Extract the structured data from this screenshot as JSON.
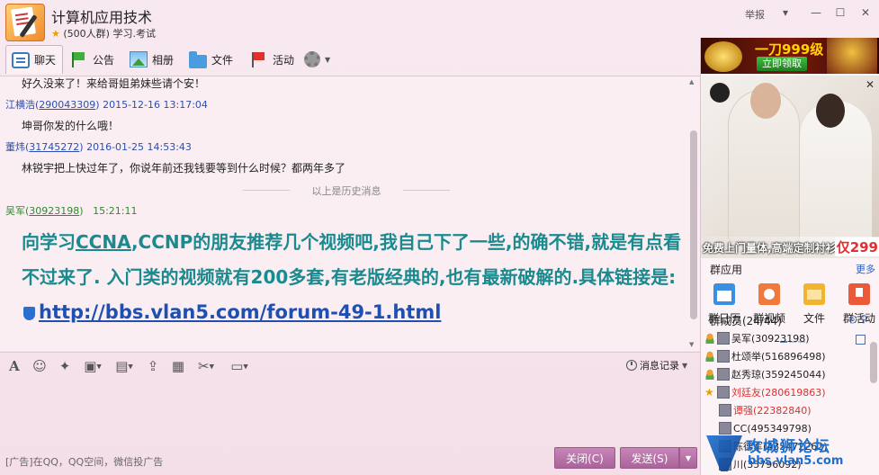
{
  "window": {
    "group_name": "计算机应用技术",
    "group_info": "(500人群) 学习.考试",
    "report_label": "举报",
    "controls": [
      "▾",
      "—",
      "☐",
      "✕"
    ]
  },
  "tabs": [
    {
      "label": "聊天",
      "icon": "chat-bubble-icon"
    },
    {
      "label": "公告",
      "icon": "flag-icon"
    },
    {
      "label": "相册",
      "icon": "photo-icon"
    },
    {
      "label": "文件",
      "icon": "folder-icon"
    },
    {
      "label": "活动",
      "icon": "red-flag-icon"
    }
  ],
  "messages": [
    {
      "text": "好久没来了！来给哥姐弟妹些请个安！"
    },
    {
      "sender": "江横浩",
      "qq": "290043309",
      "time": "2015-12-16 13:17:04",
      "text": "坤哥你发的什么哦！"
    },
    {
      "sender": "董炜",
      "qq": "31745272",
      "time": "2016-01-25 14:53:43",
      "text": "林锐宇把上快过年了，你说年前还我钱要等到什么时候？都两年多了"
    }
  ],
  "history_divider": "以上是历史消息",
  "latest": {
    "sender": "吴军",
    "qq": "30923198",
    "time": "15:21:11",
    "text_1": "向学习",
    "text_ccna": "CCNA",
    "text_2": ",CCNP的朋友推荐几个视频吧,我自己下了一些,的确不错,就是有点看不过来了. 入门类的视频就有200多套,有老版经典的,也有最新破解的.具体链接是:",
    "link": "http://bbs.vlan5.com/forum-49-1.html"
  },
  "input_toolbar": {
    "history_label": "消息记录"
  },
  "bottom": {
    "ad_text": "[广告]在QQ，QQ空间，微信投广告",
    "close_label": "关闭(C)",
    "send_label": "发送(S)"
  },
  "right_panel": {
    "banner_text": "一刀999级",
    "banner_button": "立即领取",
    "ad_caption": "免费上门量体,高端定制衬衫",
    "ad_price": "仅299",
    "apps_title": "群应用",
    "apps_more": "更多",
    "apps": [
      "群日历",
      "群视频",
      "文件",
      "群活动"
    ],
    "members_title": "群成员(24/44)",
    "members": [
      {
        "name": "吴军(30923198)",
        "tag": "person",
        "color": "normal"
      },
      {
        "name": "杜颂举(516896498)",
        "tag": "person",
        "color": "normal"
      },
      {
        "name": "赵秀琼(359245044)",
        "tag": "person",
        "color": "normal"
      },
      {
        "name": "刘廷友(280619863)",
        "tag": "star",
        "color": "red"
      },
      {
        "name": "谭强(22382840)",
        "tag": "none",
        "color": "red"
      },
      {
        "name": "CC(495349798)",
        "tag": "none",
        "color": "normal"
      },
      {
        "name": "陈德军(435472262)",
        "tag": "none",
        "color": "normal"
      },
      {
        "name": "川(35796092)",
        "tag": "none",
        "color": "normal"
      }
    ]
  },
  "watermark": {
    "title": "攻城狮论坛",
    "url": "bbs.vlan5.com"
  }
}
